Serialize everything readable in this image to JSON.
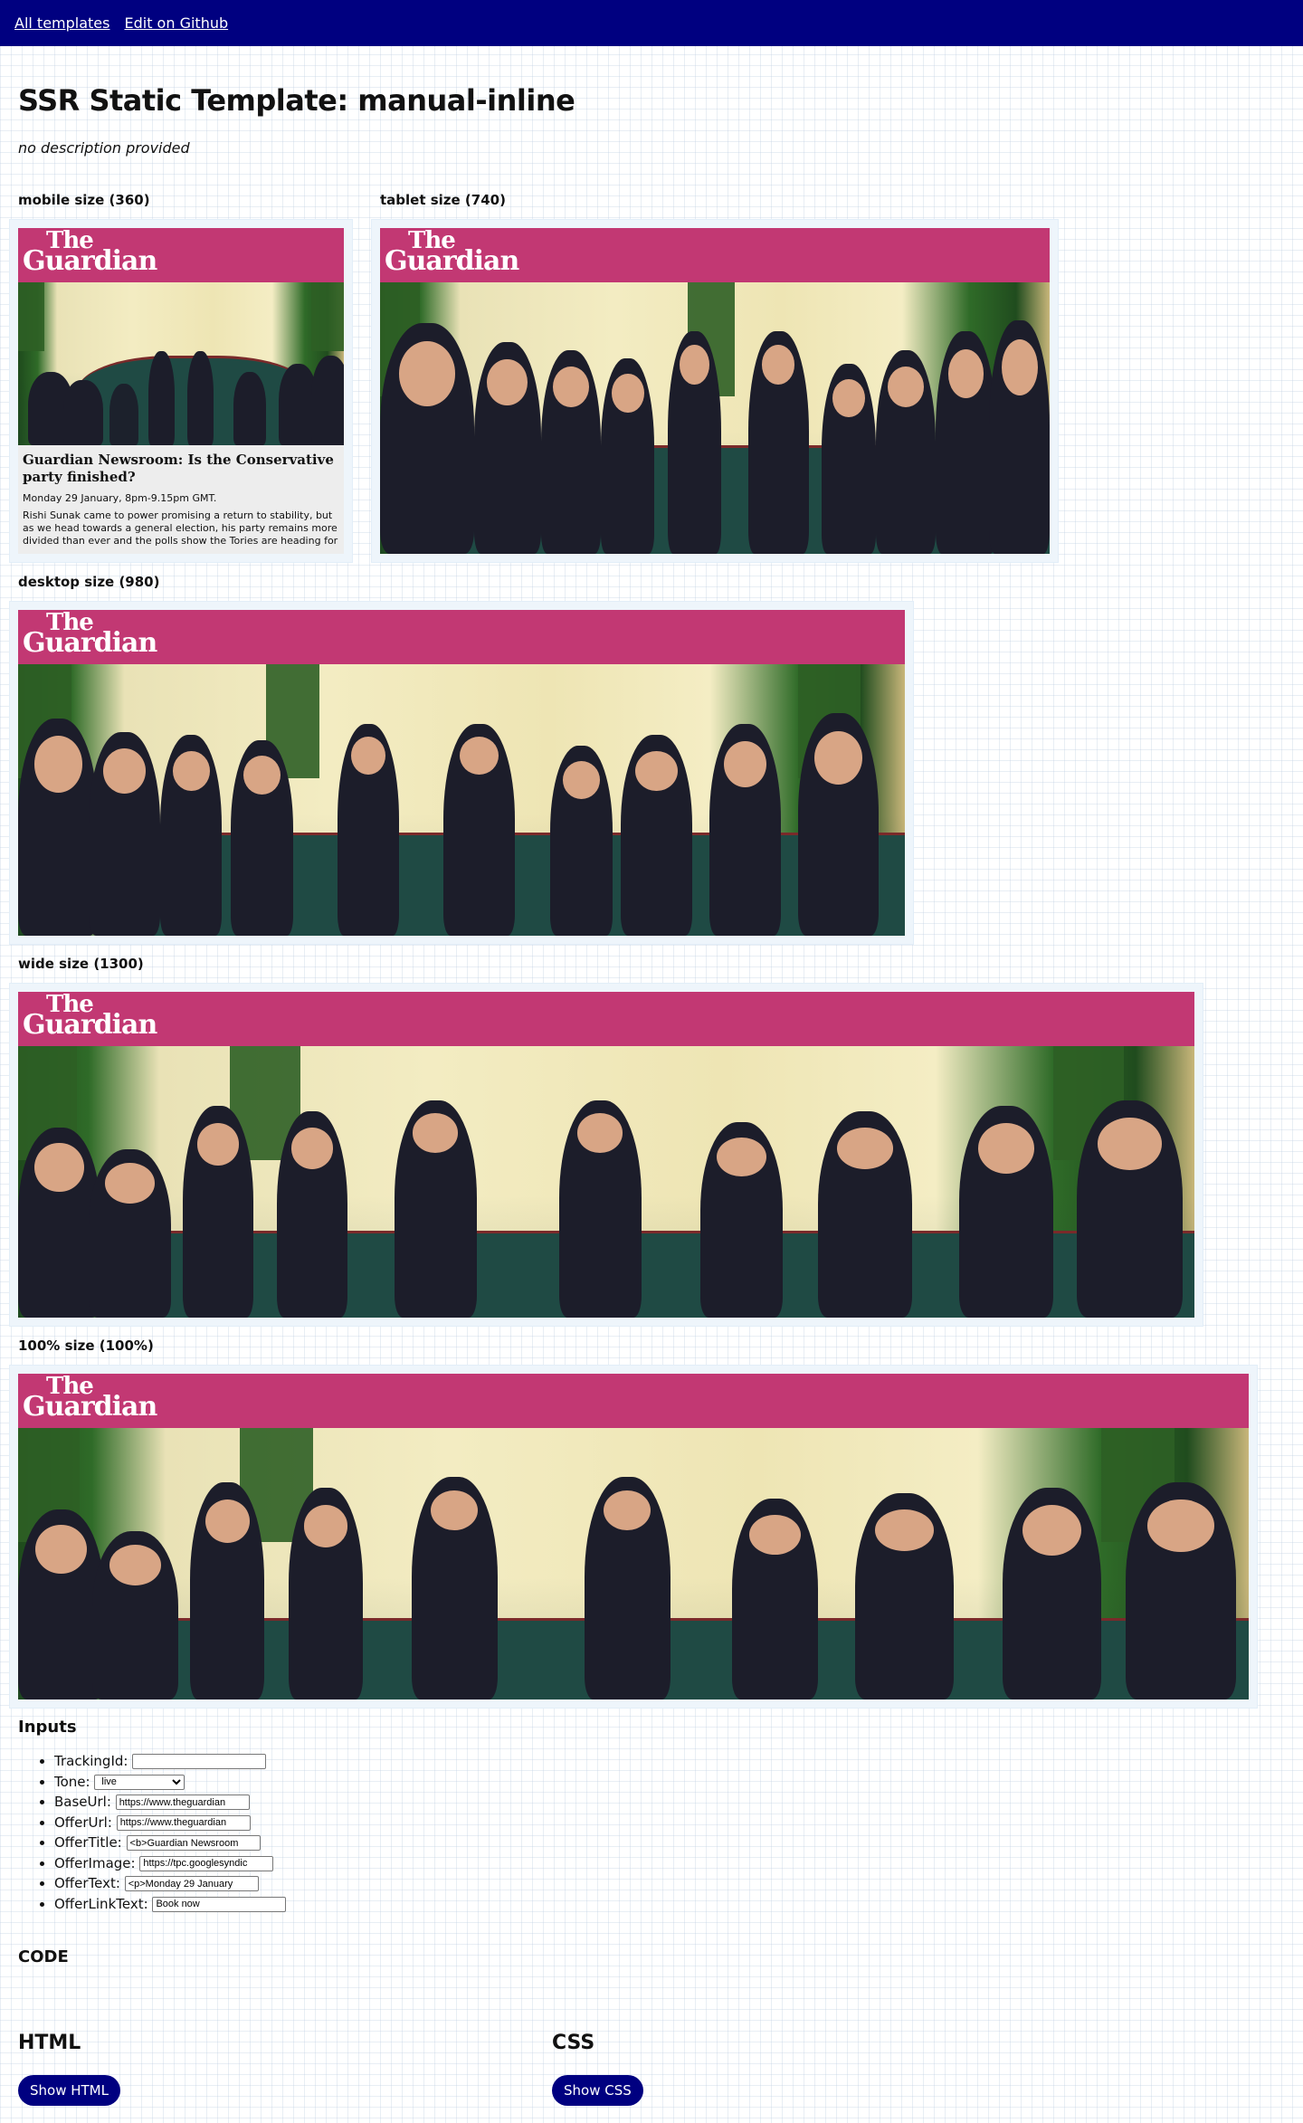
{
  "nav": {
    "all_templates": "All templates",
    "edit_on_github": "Edit on Github"
  },
  "page": {
    "title": "SSR Static Template: manual-inline",
    "description": "no description provided"
  },
  "sizes": [
    {
      "label": "mobile size (360)"
    },
    {
      "label": "tablet size (740)"
    },
    {
      "label": "desktop size (980)"
    },
    {
      "label": "wide size (1300)"
    },
    {
      "label": "100% size (100%)"
    }
  ],
  "ad": {
    "logo_the": "The",
    "logo_guardian": "Guardian",
    "image_alt": "Cabinet meeting around a green table",
    "title": "Guardian Newsroom: Is the Conservative party finished?",
    "date": "Monday 29 January, 8pm-9.15pm GMT.",
    "body": "Rishi Sunak came to power promising a return to stability, but as we head towards a general election, his party remains more divided than ever and the polls show the Tories are heading for",
    "brand_color": "#c23873"
  },
  "inputs": {
    "title": "Inputs",
    "fields": [
      {
        "label": "TrackingId:",
        "value": ""
      },
      {
        "label": "Tone:",
        "value": "live"
      },
      {
        "label": "BaseUrl:",
        "value": "https://www.theguardian"
      },
      {
        "label": "OfferUrl:",
        "value": "https://www.theguardian"
      },
      {
        "label": "OfferTitle:",
        "value": "<b>Guardian Newsroom"
      },
      {
        "label": "OfferImage:",
        "value": "https://tpc.googlesyndic"
      },
      {
        "label": "OfferText:",
        "value": "<p>Monday 29 January"
      },
      {
        "label": "OfferLinkText:",
        "value": "Book now"
      }
    ]
  },
  "code": {
    "title": "CODE",
    "html_title": "HTML",
    "css_title": "CSS",
    "show_html": "Show HTML",
    "show_css": "Show CSS"
  },
  "colors": {
    "nav_bg": "#000080",
    "button_bg": "#000080"
  }
}
